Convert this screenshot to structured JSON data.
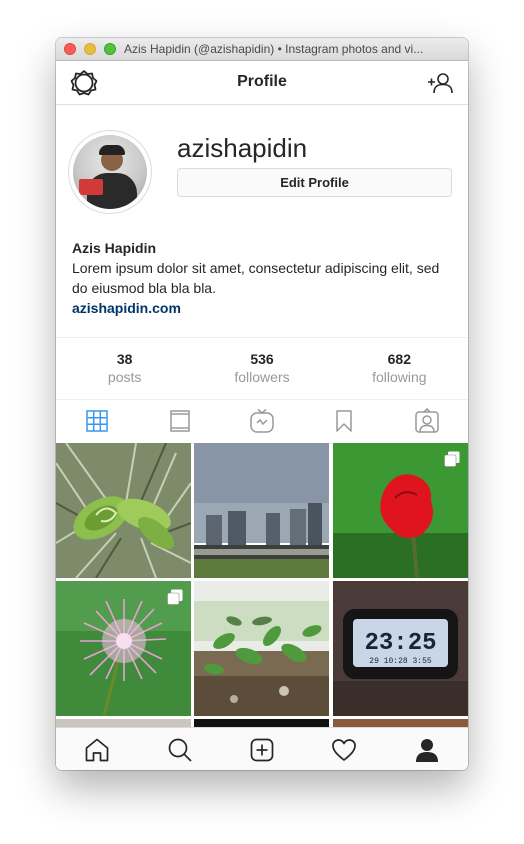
{
  "window": {
    "title": "Azis Hapidin (@azishapidin) • Instagram photos and vi..."
  },
  "navbar": {
    "title": "Profile",
    "left_icon": "settings-icon",
    "right_icon": "add-user-icon"
  },
  "profile": {
    "username": "azishapidin",
    "edit_button_label": "Edit Profile",
    "full_name": "Azis Hapidin",
    "bio_text": "Lorem ipsum dolor sit amet, consectetur adipiscing elit, sed do eiusmod bla bla bla.",
    "website": "azishapidin.com"
  },
  "stats": [
    {
      "value": "38",
      "label": "posts"
    },
    {
      "value": "536",
      "label": "followers"
    },
    {
      "value": "682",
      "label": "following"
    }
  ],
  "tabs": [
    {
      "icon": "grid-icon",
      "active": true,
      "accent": "#3897f0"
    },
    {
      "icon": "feed-icon",
      "active": false
    },
    {
      "icon": "igtv-icon",
      "active": false
    },
    {
      "icon": "bookmark-icon",
      "active": false
    },
    {
      "icon": "tagged-icon",
      "active": false
    }
  ],
  "grid": {
    "photos": [
      {
        "subject": "green plant leaves",
        "multiple": false
      },
      {
        "subject": "city towers and crowd",
        "multiple": false
      },
      {
        "subject": "red flower bud",
        "multiple": true
      },
      {
        "subject": "pink mimosa flower",
        "multiple": true
      },
      {
        "subject": "green sprouts in soil",
        "multiple": false
      },
      {
        "subject": "digital alarm clock",
        "multiple": false,
        "clock_time": "23:25",
        "clock_sub": "29 10:28 3:55"
      }
    ]
  },
  "bottom_nav": [
    {
      "icon": "home-icon"
    },
    {
      "icon": "search-icon"
    },
    {
      "icon": "new-post-icon"
    },
    {
      "icon": "activity-heart-icon"
    },
    {
      "icon": "profile-icon",
      "active": true
    }
  ]
}
